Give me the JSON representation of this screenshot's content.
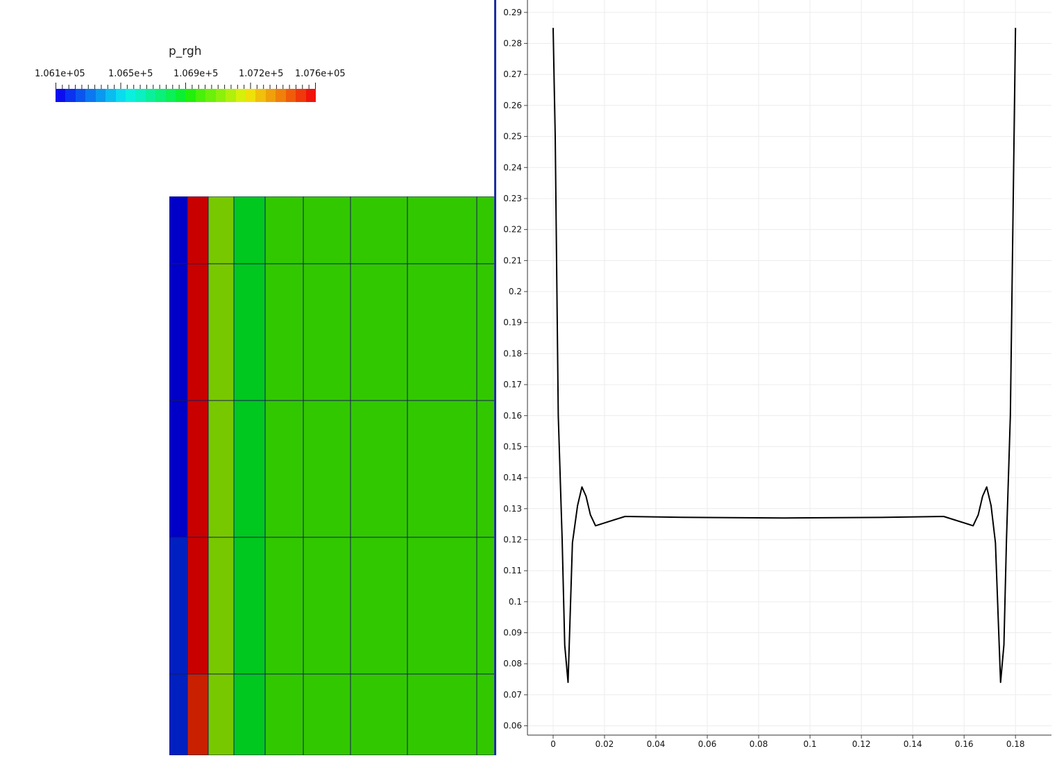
{
  "left_view": {
    "colorbar": {
      "title": "p_rgh",
      "tick_labels": [
        "1.061e+05",
        "1.065e+5",
        "1.069e+5",
        "1.072e+5",
        "1.076e+05"
      ],
      "range": [
        106100,
        107600
      ],
      "colors": [
        "#0b0df0",
        "#0a32f0",
        "#0a55f0",
        "#0a78f0",
        "#0a98f0",
        "#0abcf0",
        "#0adcf0",
        "#0af0e0",
        "#0af0c0",
        "#0af09a",
        "#0af078",
        "#0af055",
        "#0af030",
        "#20f00a",
        "#48f00a",
        "#6af00a",
        "#8cf00a",
        "#b0f00a",
        "#d6f00a",
        "#f0e00a",
        "#f0c00a",
        "#f0a00a",
        "#f0800a",
        "#f05c0a",
        "#f0380a",
        "#f0140a"
      ]
    },
    "mesh": {
      "cell_colors": [
        [
          "#0000c8",
          "#c80000",
          "#78c800",
          "#00c81e",
          "#32c800",
          "#32c800",
          "#32c800",
          "#32c800",
          "#32c800"
        ],
        [
          "#0000c8",
          "#c80000",
          "#78c800",
          "#00c81e",
          "#32c800",
          "#32c800",
          "#32c800",
          "#32c800",
          "#32c800"
        ],
        [
          "#0000c8",
          "#c80000",
          "#78c800",
          "#00c81e",
          "#32c800",
          "#32c800",
          "#32c800",
          "#32c800",
          "#32c800"
        ],
        [
          "#0020c0",
          "#c80000",
          "#78c800",
          "#00c81e",
          "#32c800",
          "#32c800",
          "#32c800",
          "#32c800",
          "#32c800"
        ],
        [
          "#0020c0",
          "#c82000",
          "#78c800",
          "#00c81e",
          "#32c800",
          "#32c800",
          "#32c800",
          "#32c800",
          "#32c800"
        ]
      ]
    }
  },
  "chart_data": {
    "type": "line",
    "title": "",
    "xlabel": "",
    "ylabel": "",
    "xlim": [
      -0.01,
      0.194
    ],
    "ylim": [
      0.057,
      0.294
    ],
    "x_ticks": [
      "0",
      "0.02",
      "0.04",
      "0.06",
      "0.08",
      "0.1",
      "0.12",
      "0.14",
      "0.16",
      "0.18"
    ],
    "y_ticks": [
      "0.06",
      "0.07",
      "0.08",
      "0.09",
      "0.1",
      "0.11",
      "0.12",
      "0.13",
      "0.14",
      "0.15",
      "0.16",
      "0.17",
      "0.18",
      "0.19",
      "0.2",
      "0.21",
      "0.22",
      "0.23",
      "0.24",
      "0.25",
      "0.26",
      "0.27",
      "0.28",
      "0.29"
    ],
    "grid": true,
    "series": [
      {
        "color": "#000000",
        "x": [
          0,
          0.0008,
          0.002,
          0.0035,
          0.0045,
          0.0058,
          0.0075,
          0.0095,
          0.0112,
          0.0128,
          0.0145,
          0.0165,
          0.028,
          0.05,
          0.09,
          0.13,
          0.152,
          0.1635,
          0.1655,
          0.1672,
          0.1688,
          0.1705,
          0.1722,
          0.1742,
          0.1755,
          0.1765,
          0.178,
          0.18
        ],
        "y": [
          0.285,
          0.25,
          0.16,
          0.12,
          0.086,
          0.074,
          0.119,
          0.131,
          0.137,
          0.134,
          0.128,
          0.1245,
          0.1275,
          0.1272,
          0.127,
          0.1272,
          0.1275,
          0.1245,
          0.128,
          0.134,
          0.137,
          0.131,
          0.119,
          0.074,
          0.086,
          0.12,
          0.16,
          0.285
        ]
      }
    ]
  }
}
